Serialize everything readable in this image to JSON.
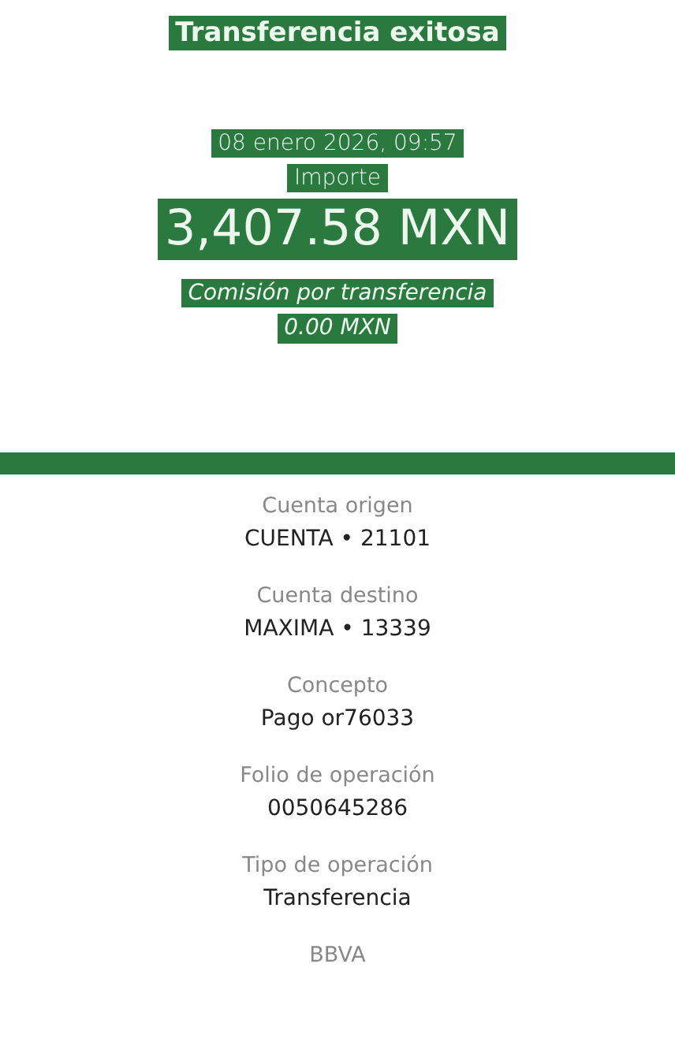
{
  "header": {
    "title": "Transferencia exitosa",
    "date": "08 enero 2026, 09:57",
    "amount_label": "Importe",
    "amount": "3,407.58 MXN",
    "fee_label": "Comisión por transferencia",
    "fee": "0.00 MXN"
  },
  "details": [
    {
      "label": "Cuenta origen",
      "value": "CUENTA • 21101"
    },
    {
      "label": "Cuenta destino",
      "value": "MAXIMA • 13339"
    },
    {
      "label": "Concepto",
      "value": "Pago or76033"
    },
    {
      "label": "Folio de operación",
      "value": "0050645286"
    },
    {
      "label": "Tipo de operación",
      "value": "Transferencia"
    }
  ],
  "footer": "BBVA"
}
